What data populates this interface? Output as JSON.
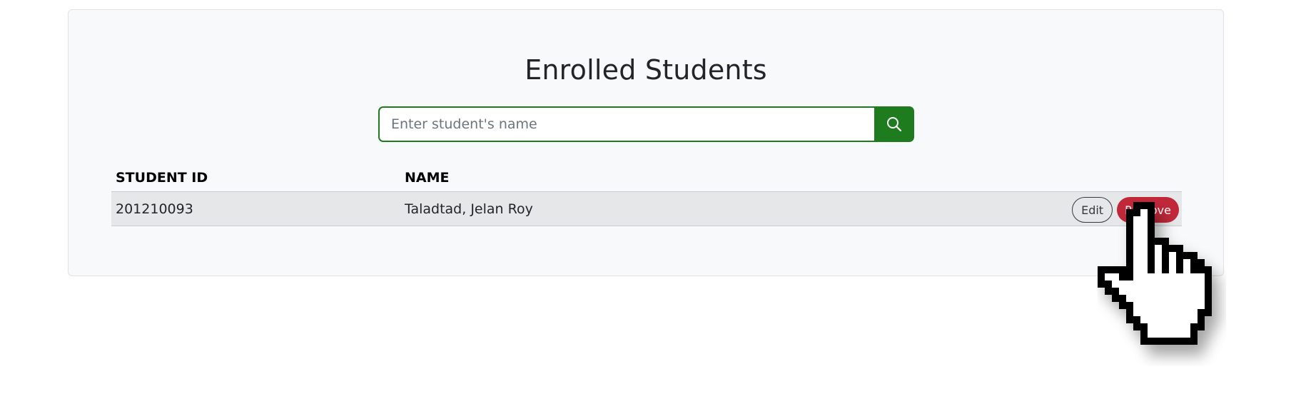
{
  "panel": {
    "title": "Enrolled Students"
  },
  "search": {
    "placeholder": "Enter student's name",
    "value": "",
    "button_icon": "search-icon"
  },
  "table": {
    "headers": [
      "STUDENT ID",
      "NAME"
    ],
    "rows": [
      {
        "student_id": "201210093",
        "name": "Taladtad, Jelan Roy",
        "actions": {
          "edit_label": "Edit",
          "remove_label": "Remove"
        }
      }
    ]
  },
  "colors": {
    "accent_green": "#1e7b1e",
    "remove_red": "#c0283a",
    "row_highlight": "#e6e7e8",
    "panel_bg": "#f8f9fa"
  },
  "cursor": {
    "icon": "hand-pointer-icon"
  }
}
